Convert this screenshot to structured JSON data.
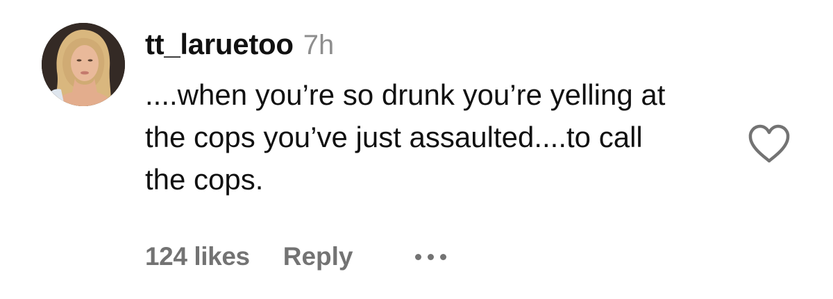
{
  "comment": {
    "username": "tt_laruetoo",
    "time": "7h",
    "text": "....when you’re so drunk you’re yelling at the cops you’ve just assaulted....to call the cops.",
    "likes": "124 likes",
    "reply_label": "Reply",
    "avatar_icon": "user-avatar",
    "like_icon": "heart-outline-icon",
    "more_icon": "more-horizontal-icon"
  },
  "colors": {
    "text": "#111111",
    "secondary": "#737373",
    "timestamp": "#8e8e8e",
    "background": "#ffffff"
  }
}
